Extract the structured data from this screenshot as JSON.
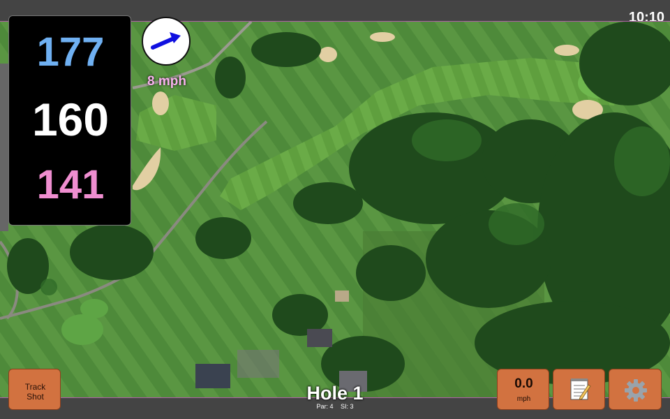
{
  "status": {
    "time": "10:10"
  },
  "distances": {
    "back": "177",
    "middle": "160",
    "front": "141"
  },
  "wind": {
    "speed_label": "8 mph",
    "direction_icon": "arrow-icon",
    "arrow_color": "#1010e0"
  },
  "hole": {
    "title": "Hole 1",
    "par_label": "Par: 4",
    "si_label": "SI: 3"
  },
  "buttons": {
    "track_shot_line1": "Track",
    "track_shot_line2": "Shot",
    "wind_value": "0.0",
    "wind_unit": "mph",
    "notes_icon": "notepad-icon",
    "settings_icon": "gear-icon"
  },
  "colors": {
    "back_distance": "#6fb0f2",
    "middle_distance": "#ffffff",
    "front_distance": "#ef8ed0",
    "button_fill": "#d27240",
    "accent_border": "#b060a8"
  }
}
